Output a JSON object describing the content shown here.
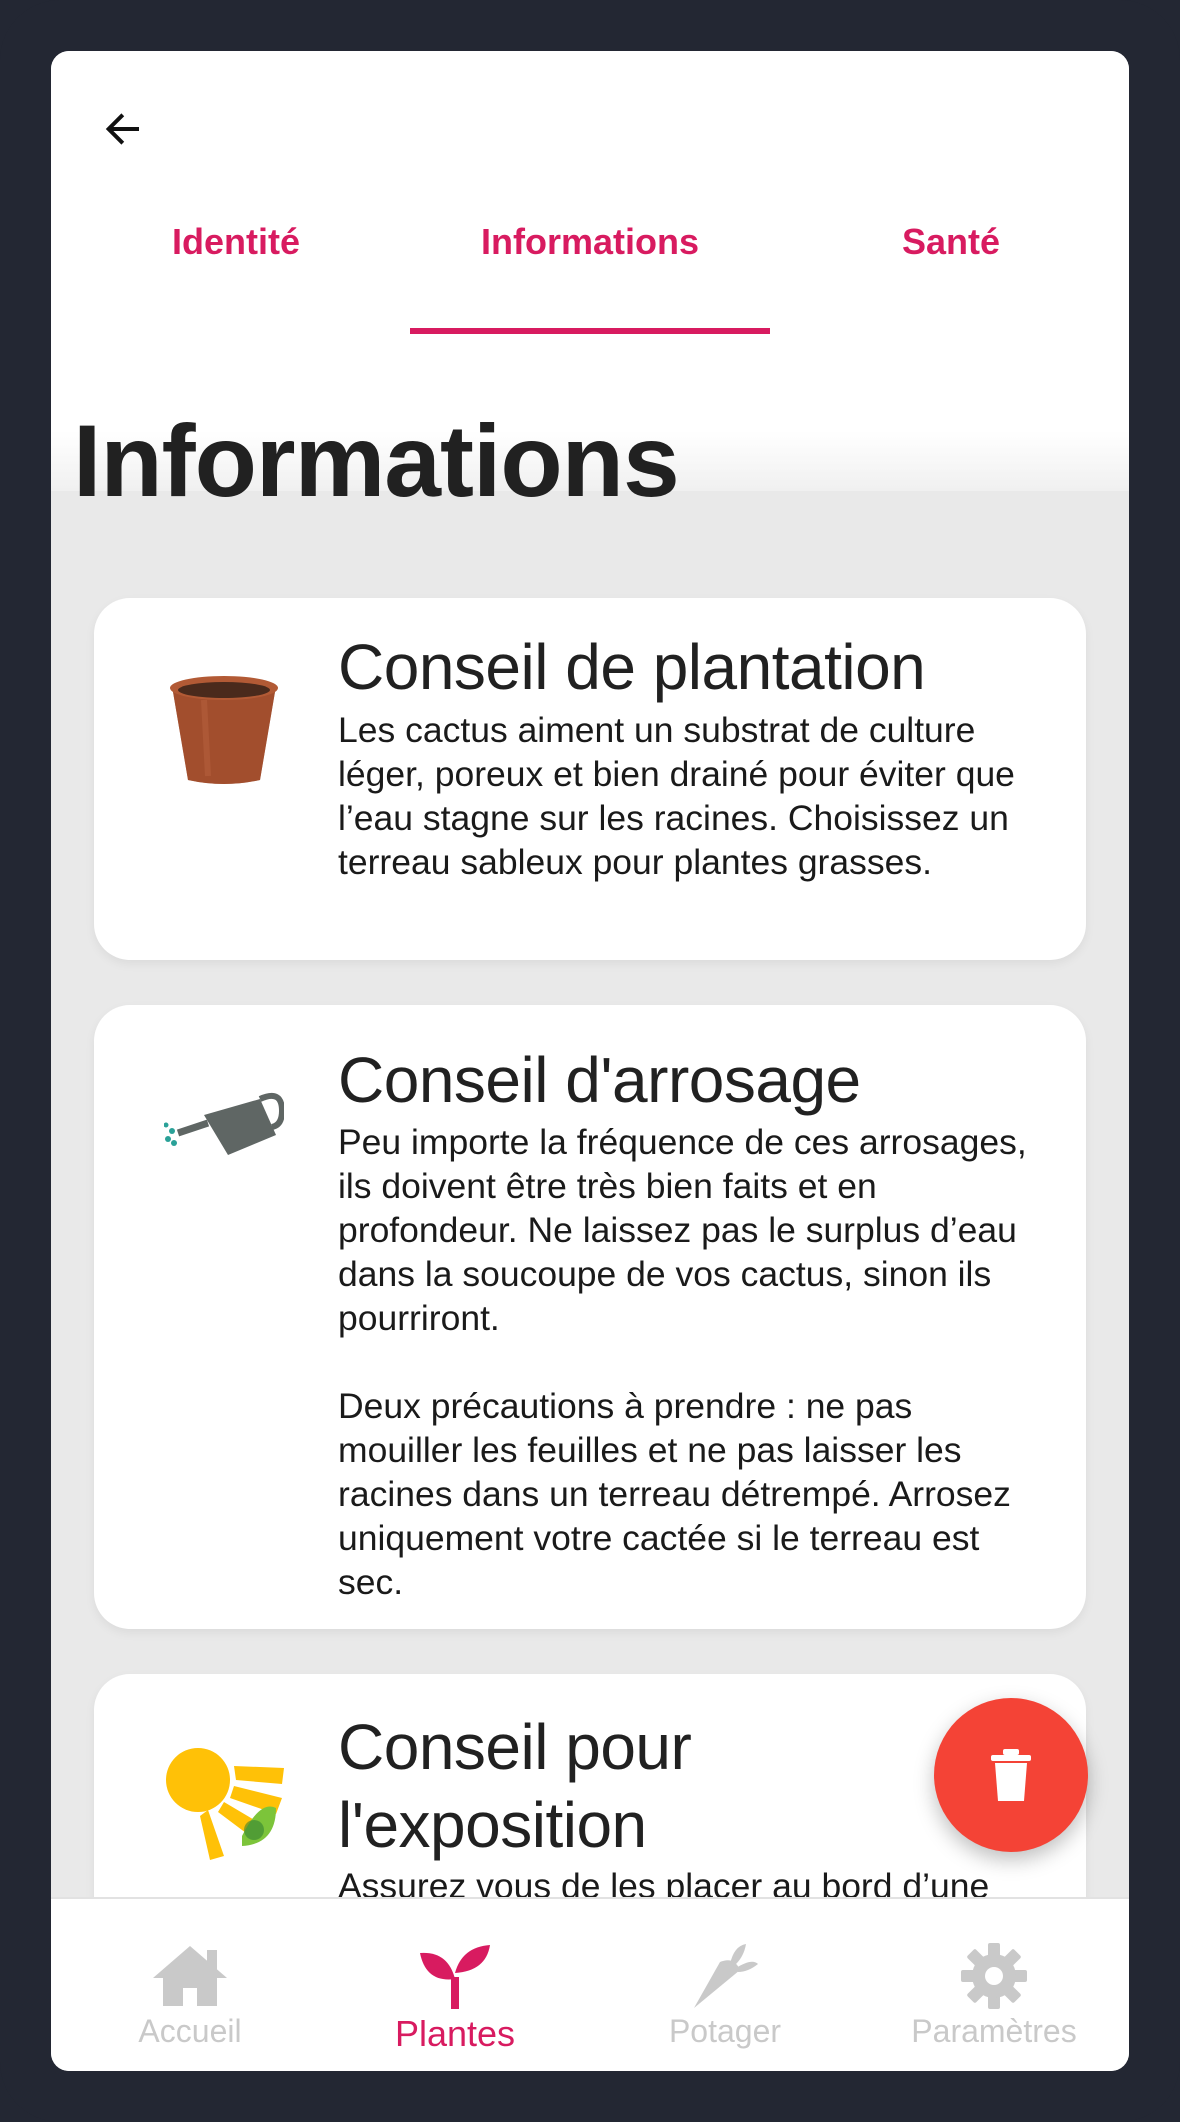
{
  "tabs": [
    {
      "label": "Identité",
      "active": false
    },
    {
      "label": "Informations",
      "active": true
    },
    {
      "label": "Santé",
      "active": false
    }
  ],
  "page": {
    "title": "Informations"
  },
  "cards": [
    {
      "icon": "flower-pot-icon",
      "title": "Conseil de plantation",
      "text": "Les cactus aiment un substrat de culture léger, poreux et bien drainé pour éviter que l’eau stagne sur les racines. Choisissez un terreau sableux pour plantes grasses."
    },
    {
      "icon": "watering-can-icon",
      "title": "Conseil d'arrosage",
      "text": "Peu importe la fréquence de ces arrosages, ils doivent être très bien faits et en profondeur. Ne laissez pas le surplus d’eau dans la soucoupe de vos cactus, sinon ils pourriront.\n\nDeux précautions à prendre : ne pas mouiller les feuilles et ne pas laisser les racines dans un terreau détrempé. Arrosez uniquement votre cactée si le terreau est sec."
    },
    {
      "icon": "sun-plant-icon",
      "title": "Conseil pour l'exposition",
      "text": "Assurez vous de les placer au bord d’une fenêtre ou, mieux encore, à"
    }
  ],
  "fab": {
    "icon": "trash-icon",
    "color": "#f44336"
  },
  "bottom_nav": [
    {
      "label": "Accueil",
      "icon": "home-icon",
      "active": false
    },
    {
      "label": "Plantes",
      "icon": "sprout-icon",
      "active": true
    },
    {
      "label": "Potager",
      "icon": "carrot-icon",
      "active": false
    },
    {
      "label": "Paramètres",
      "icon": "gear-icon",
      "active": false
    }
  ],
  "colors": {
    "accent": "#d81b60",
    "frame": "#232733",
    "inactive_nav": "#c9c9c9"
  }
}
